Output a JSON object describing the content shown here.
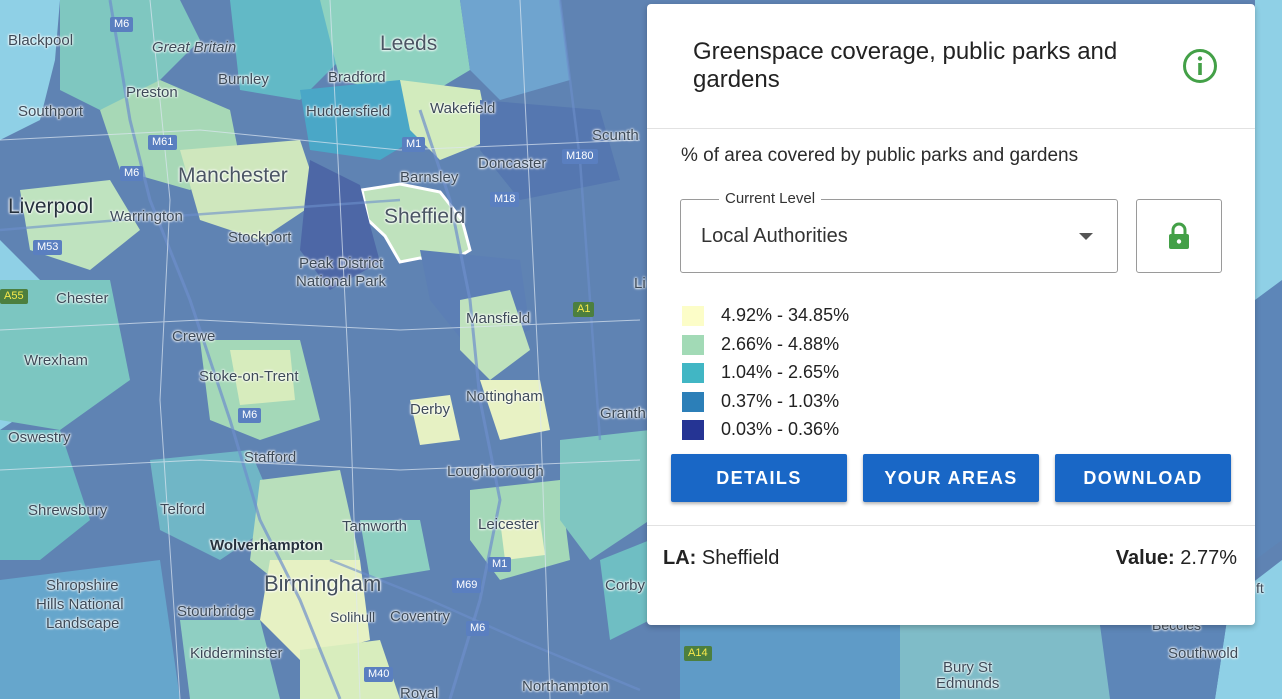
{
  "panel": {
    "title": "Greenspace coverage, public parks and gardens",
    "subtitle": "% of area covered by public parks and gardens",
    "level_select": {
      "legend": "Current Level",
      "value": "Local Authorities"
    },
    "legend": [
      {
        "label": "4.92% - 34.85%",
        "color": "#fcfdc8"
      },
      {
        "label": "2.66% - 4.88%",
        "color": "#a2dab6"
      },
      {
        "label": "1.04% - 2.65%",
        "color": "#41b6c4"
      },
      {
        "label": "0.37% - 1.03%",
        "color": "#2c7fb8"
      },
      {
        "label": "0.03% - 0.36%",
        "color": "#253494"
      }
    ],
    "buttons": {
      "details": "DETAILS",
      "your_areas": "YOUR AREAS",
      "download": "DOWNLOAD"
    },
    "footer": {
      "la_label": "LA:",
      "la_value": "Sheffield",
      "value_label": "Value:",
      "value_value": "2.77%"
    },
    "colors": {
      "accent_green": "#43a047",
      "button_blue": "#1967c6"
    },
    "icons": {
      "info": "info-icon",
      "lock": "lock-icon",
      "dropdown": "chevron-down-icon"
    }
  },
  "map": {
    "places": {
      "blackpool": "Blackpool",
      "great_britain": "Great Britain",
      "leeds": "Leeds",
      "burnley": "Burnley",
      "bradford": "Bradford",
      "preston": "Preston",
      "southport": "Southport",
      "huddersfield": "Huddersfield",
      "wakefield": "Wakefield",
      "scunthorpe": "Scunth",
      "doncaster": "Doncaster",
      "manchester": "Manchester",
      "barnsley": "Barnsley",
      "liverpool": "Liverpool",
      "warrington": "Warrington",
      "sheffield": "Sheffield",
      "stockport": "Stockport",
      "peak_district": "Peak District",
      "national_park": "National Park",
      "chester": "Chester",
      "mansfield": "Mansfield",
      "crewe": "Crewe",
      "wrexham": "Wrexham",
      "stoke": "Stoke-on-Trent",
      "nottingham": "Nottingham",
      "derby": "Derby",
      "oswestry": "Oswestry",
      "grantham": "Granth",
      "stafford": "Stafford",
      "loughborough": "Loughborough",
      "shrewsbury": "Shrewsbury",
      "telford": "Telford",
      "tamworth": "Tamworth",
      "leicester": "Leicester",
      "wolverhampton": "Wolverhampton",
      "birmingham": "Birmingham",
      "shropshire1": "Shropshire",
      "shropshire2": "Hills National",
      "shropshire3": "Landscape",
      "stourbridge": "Stourbridge",
      "solihull": "Solihull",
      "coventry": "Coventry",
      "kidderminster": "Kidderminster",
      "corby": "Corby",
      "northampton": "Northampton",
      "royal": "Royal",
      "bury": "Bury St",
      "edmunds": "Edmunds",
      "southwold": "Southwold",
      "beccles": "Beccles",
      "lincoln": "Li",
      "ft": "ft"
    },
    "roads": {
      "m6_a": "M6",
      "m61": "M61",
      "m6_b": "M6",
      "m53": "M53",
      "a55": "A55",
      "m1_a": "M1",
      "m18": "M18",
      "m180": "M180",
      "a1": "A1",
      "m6_c": "M6",
      "m69": "M69",
      "m1_b": "M1",
      "m6_d": "M6",
      "m40": "M40",
      "a14": "A14"
    }
  }
}
